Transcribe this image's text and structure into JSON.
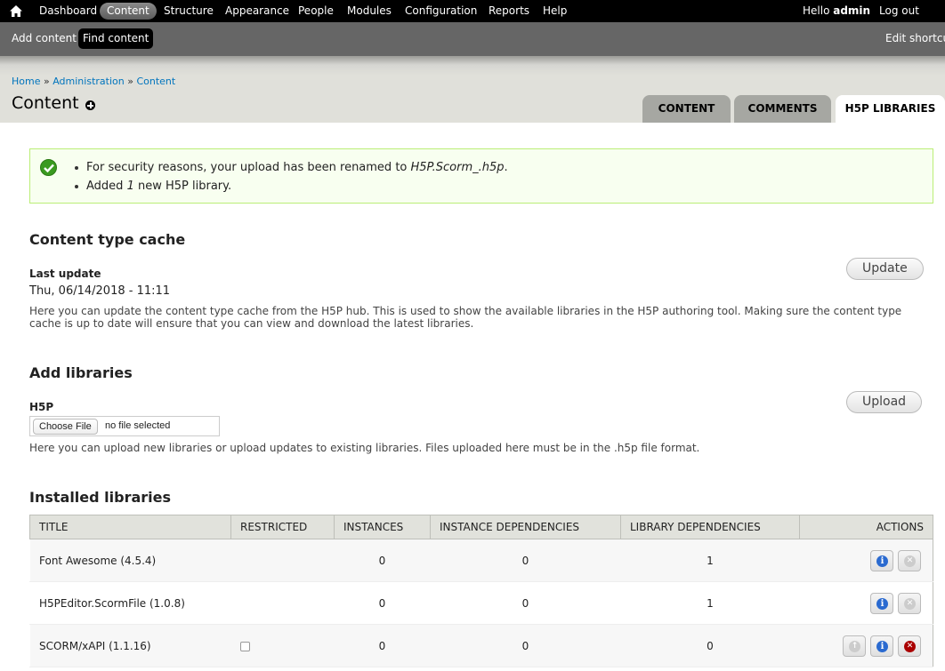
{
  "toolbar": {
    "home_icon": "home-icon",
    "items": [
      {
        "label": "Dashboard"
      },
      {
        "label": "Content",
        "active": true
      },
      {
        "label": "Structure"
      },
      {
        "label": "Appearance"
      },
      {
        "label": "People"
      },
      {
        "label": "Modules"
      },
      {
        "label": "Configuration"
      },
      {
        "label": "Reports"
      },
      {
        "label": "Help"
      }
    ],
    "hello_prefix": "Hello ",
    "user": "admin",
    "logout": "Log out"
  },
  "shortcuts": {
    "items": [
      {
        "label": "Add content"
      },
      {
        "label": "Find content",
        "active": true
      }
    ],
    "edit": "Edit shortcuts"
  },
  "header": {
    "breadcrumb": [
      "Home",
      "Administration",
      "Content"
    ],
    "separator": "»",
    "title": "Content",
    "tabs": [
      {
        "label": "CONTENT"
      },
      {
        "label": "COMMENTS"
      },
      {
        "label": "H5P LIBRARIES",
        "active": true
      }
    ]
  },
  "message": {
    "status": "success",
    "line1_prefix": "For security reasons, your upload has been renamed to ",
    "line1_file": "H5P.Scorm_.h5p",
    "line1_suffix": ".",
    "line2_prefix": "Added ",
    "line2_count": "1",
    "line2_suffix": " new H5P library."
  },
  "cache": {
    "heading": "Content type cache",
    "last_update_label": "Last update",
    "last_update_value": "Thu, 06/14/2018 - 11:11",
    "description": "Here you can update the content type cache from the H5P hub. This is used to show the available libraries in the H5P authoring tool. Making sure the content type cache is up to date will ensure that you can view and download the latest libraries.",
    "button": "Update"
  },
  "add": {
    "heading": "Add libraries",
    "field_label": "H5P",
    "choose_file": "Choose File",
    "file_status": "no file selected",
    "description": "Here you can upload new libraries or upload updates to existing libraries. Files uploaded here must be in the .h5p file format.",
    "button": "Upload"
  },
  "installed": {
    "heading": "Installed libraries",
    "columns": [
      "TITLE",
      "RESTRICTED",
      "INSTANCES",
      "INSTANCE DEPENDENCIES",
      "LIBRARY DEPENDENCIES",
      "ACTIONS"
    ],
    "rows": [
      {
        "title": "Font Awesome (4.5.4)",
        "restricted": null,
        "instances": "0",
        "instance_deps": "0",
        "library_deps": "1",
        "actions": [
          "info",
          "delete-disabled"
        ]
      },
      {
        "title": "H5PEditor.ScormFile (1.0.8)",
        "restricted": null,
        "instances": "0",
        "instance_deps": "0",
        "library_deps": "1",
        "actions": [
          "info",
          "delete-disabled"
        ]
      },
      {
        "title": "SCORM/xAPI (1.1.16)",
        "restricted": false,
        "instances": "0",
        "instance_deps": "0",
        "library_deps": "0",
        "actions": [
          "upgrade-disabled",
          "info",
          "delete"
        ]
      }
    ]
  }
}
